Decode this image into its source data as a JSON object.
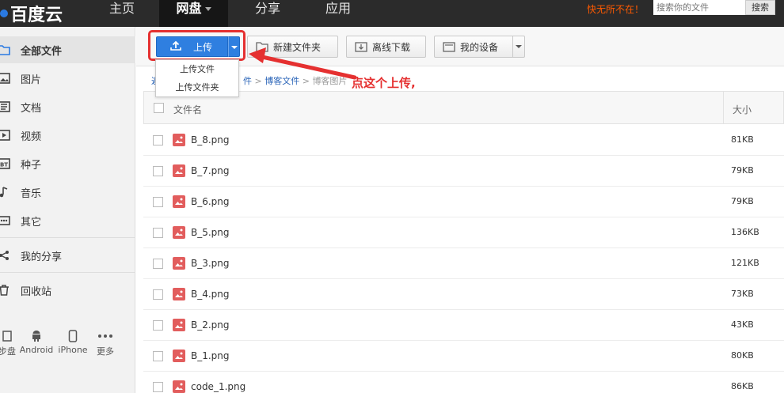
{
  "topbar": {
    "logo": "百度云",
    "nav": [
      {
        "label": "主页"
      },
      {
        "label": "网盘"
      },
      {
        "label": "分享"
      },
      {
        "label": "应用"
      }
    ],
    "promo": "快无所不在！",
    "search_placeholder": "搜索你的文件",
    "search_button": "搜索"
  },
  "sidebar": {
    "items": [
      {
        "label": "全部文件",
        "icon": "folder-icon"
      },
      {
        "label": "图片",
        "icon": "image-icon"
      },
      {
        "label": "文档",
        "icon": "document-icon"
      },
      {
        "label": "视频",
        "icon": "video-icon"
      },
      {
        "label": "种子",
        "icon": "bt-icon"
      },
      {
        "label": "音乐",
        "icon": "music-icon"
      },
      {
        "label": "其它",
        "icon": "more-icon"
      },
      {
        "label": "我的分享",
        "icon": "share-icon"
      },
      {
        "label": "回收站",
        "icon": "trash-icon"
      }
    ],
    "devices": [
      {
        "label": "步盘"
      },
      {
        "label": "Android"
      },
      {
        "label": "iPhone"
      },
      {
        "label": "更多"
      }
    ]
  },
  "toolbar": {
    "upload": "上传",
    "new_folder": "新建文件夹",
    "offline": "离线下载",
    "devices": "我的设备"
  },
  "upload_menu": {
    "items": [
      "上传文件",
      "上传文件夹"
    ]
  },
  "breadcrumb": {
    "first": "返",
    "second": "件",
    "third": "博客文件",
    "current": "博客图片"
  },
  "annotation": "点这个上传,",
  "table": {
    "col_name": "文件名",
    "col_size": "大小",
    "rows": [
      {
        "name": "B_8.png",
        "size": "81KB"
      },
      {
        "name": "B_7.png",
        "size": "79KB"
      },
      {
        "name": "B_6.png",
        "size": "79KB"
      },
      {
        "name": "B_5.png",
        "size": "136KB"
      },
      {
        "name": "B_3.png",
        "size": "121KB"
      },
      {
        "name": "B_4.png",
        "size": "73KB"
      },
      {
        "name": "B_2.png",
        "size": "43KB"
      },
      {
        "name": "B_1.png",
        "size": "80KB"
      },
      {
        "name": "code_1.png",
        "size": "86KB"
      }
    ]
  },
  "colors": {
    "accent": "#2f7fe0",
    "highlight": "#e53030",
    "topbar": "#2b2b2b",
    "promo": "#ff5a00"
  }
}
